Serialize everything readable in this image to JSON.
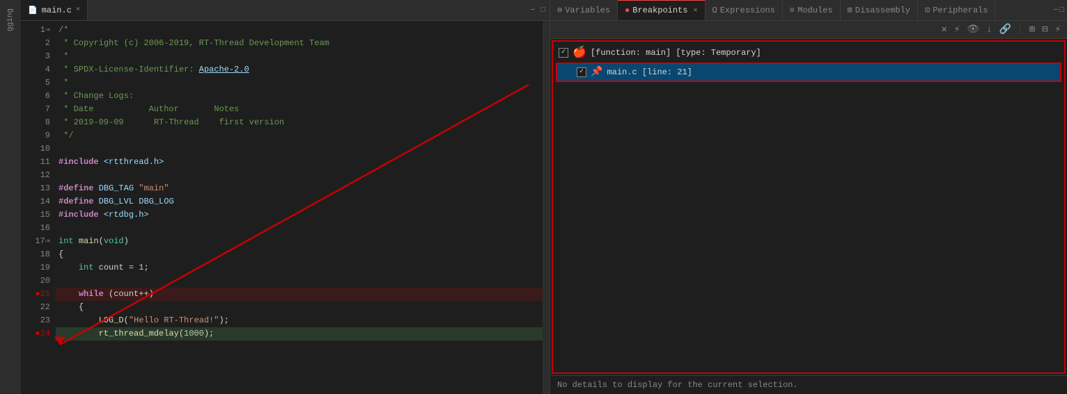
{
  "editor": {
    "tab": {
      "filename": "main.c",
      "close_icon": "×"
    },
    "tab_actions": {
      "minimize": "−",
      "maximize": "□"
    },
    "lines": [
      {
        "num": "1",
        "arrow": true,
        "content": "/*",
        "type": "comment"
      },
      {
        "num": "2",
        "content": " * Copyright (c) 2006-2019, RT-Thread Development Team",
        "type": "comment"
      },
      {
        "num": "3",
        "content": " *",
        "type": "comment"
      },
      {
        "num": "4",
        "content": " * SPDX-License-Identifier: Apache-2.0",
        "type": "comment_link"
      },
      {
        "num": "5",
        "content": " *",
        "type": "comment"
      },
      {
        "num": "6",
        "content": " * Change Logs:",
        "type": "comment"
      },
      {
        "num": "7",
        "content": " * Date           Author       Notes",
        "type": "comment"
      },
      {
        "num": "8",
        "content": " * 2019-09-09      RT-Thread    first version",
        "type": "comment"
      },
      {
        "num": "9",
        "content": " */",
        "type": "comment"
      },
      {
        "num": "10",
        "content": "",
        "type": "normal"
      },
      {
        "num": "11",
        "content": "#include <rtthread.h>",
        "type": "include"
      },
      {
        "num": "12",
        "content": "",
        "type": "normal"
      },
      {
        "num": "13",
        "content": "#define DBG_TAG \"main\"",
        "type": "define_str"
      },
      {
        "num": "14",
        "content": "#define DBG_LVL DBG_LOG",
        "type": "define_macro"
      },
      {
        "num": "15",
        "content": "#include <rtdbg.h>",
        "type": "include"
      },
      {
        "num": "16",
        "content": "",
        "type": "normal"
      },
      {
        "num": "17",
        "content": "int main(void)",
        "type": "func_decl",
        "arrow": false
      },
      {
        "num": "18",
        "content": "{",
        "type": "normal"
      },
      {
        "num": "19",
        "content": "    int count = 1;",
        "type": "var_decl"
      },
      {
        "num": "20",
        "content": "",
        "type": "normal"
      },
      {
        "num": "21",
        "content": "    while (count++)",
        "type": "breakpoint",
        "is_breakpoint": true
      },
      {
        "num": "22",
        "content": "    {",
        "type": "normal"
      },
      {
        "num": "23",
        "content": "        LOG_D(\"Hello RT-Thread!\");",
        "type": "macro_call"
      },
      {
        "num": "24",
        "content": "        rt_thread_mdelay(1000);",
        "type": "func_call",
        "highlighted": true
      }
    ]
  },
  "sidebar": {
    "label": "gging"
  },
  "debug": {
    "tabs": [
      {
        "id": "variables",
        "label": "Variables",
        "icon": "=",
        "active": false
      },
      {
        "id": "breakpoints",
        "label": "Breakpoints",
        "icon": "●",
        "active": true
      },
      {
        "id": "expressions",
        "label": "Expressions",
        "icon": "Ω",
        "active": false
      },
      {
        "id": "modules",
        "label": "Modules",
        "icon": "≡",
        "active": false
      },
      {
        "id": "disassembly",
        "label": "Disassembly",
        "icon": "⊞",
        "active": false
      },
      {
        "id": "peripherals",
        "label": "Peripherals",
        "icon": "⊡",
        "active": false
      }
    ],
    "toolbar_buttons": [
      "✕",
      "⚙",
      "👁",
      "↓",
      "🚫",
      "⊞",
      "⊟",
      "⚡"
    ],
    "breakpoints": [
      {
        "id": "bp1",
        "checked": true,
        "icon": "●",
        "text": "[function: main] [type: Temporary]",
        "sub": {
          "checked": true,
          "icon": "📌",
          "text": "main.c [line: 21]",
          "selected": true
        }
      }
    ],
    "status": "No details to display for the current selection."
  }
}
